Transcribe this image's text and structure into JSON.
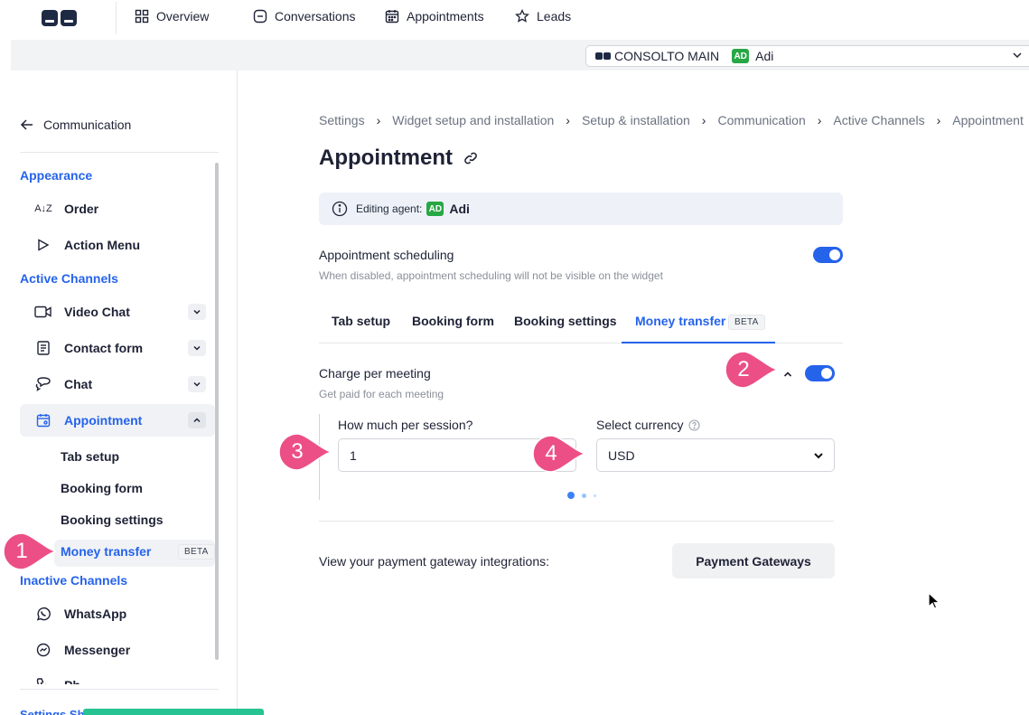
{
  "topnav": {
    "items": [
      {
        "label": "Overview",
        "icon": "grid-icon"
      },
      {
        "label": "Conversations",
        "icon": "chat-bubble-icon"
      },
      {
        "label": "Appointments",
        "icon": "calendar-icon"
      },
      {
        "label": "Leads",
        "icon": "star-icon"
      }
    ]
  },
  "agent_selector": {
    "account": "CONSOLTO MAIN",
    "agent_initials": "AD",
    "agent_name": "Adi"
  },
  "sidebar": {
    "back_label": "Communication",
    "sections": {
      "appearance": "Appearance",
      "active_channels": "Active Channels",
      "inactive_channels": "Inactive Channels",
      "settings_cutoff": "Settings Sh"
    },
    "appearance_items": [
      {
        "label": "Order",
        "icon": "sort-az-icon"
      },
      {
        "label": "Action Menu",
        "icon": "pointer-icon"
      }
    ],
    "active_items": [
      {
        "label": "Video Chat",
        "icon": "video-icon"
      },
      {
        "label": "Contact form",
        "icon": "form-icon"
      },
      {
        "label": "Chat",
        "icon": "chat-icon"
      },
      {
        "label": "Appointment",
        "icon": "calendar-icon"
      }
    ],
    "appointment_sub": [
      "Tab setup",
      "Booking form",
      "Booking settings",
      "Money transfer"
    ],
    "beta_label": "BETA",
    "inactive_items": [
      {
        "label": "WhatsApp",
        "icon": "whatsapp-icon"
      },
      {
        "label": "Messenger",
        "icon": "messenger-icon"
      },
      {
        "label": "Ph",
        "icon": "phone-icon"
      }
    ]
  },
  "breadcrumb": [
    "Settings",
    "Widget setup and installation",
    "Setup & installation",
    "Communication",
    "Active Channels",
    "Appointment"
  ],
  "page": {
    "title": "Appointment",
    "editing_label": "Editing agent:",
    "agent_initials": "AD",
    "agent_name": "Adi"
  },
  "scheduling": {
    "label": "Appointment scheduling",
    "description": "When disabled, appointment scheduling will not be visible on the widget",
    "enabled": true
  },
  "tabs": [
    "Tab setup",
    "Booking form",
    "Booking settings",
    "Money transfer"
  ],
  "tab_beta": "BETA",
  "charge": {
    "label": "Charge per meeting",
    "description": "Get paid for each meeting",
    "enabled": true,
    "session_label": "How much per session?",
    "session_value": "1",
    "currency_label": "Select currency",
    "currency_value": "USD"
  },
  "gateway": {
    "text": "View your payment gateway integrations:",
    "button": "Payment Gateways"
  },
  "markers": [
    "1",
    "2",
    "3",
    "4"
  ],
  "colors": {
    "accent": "#2563eb",
    "marker": "#ec4f86",
    "agent_badge": "#28a745",
    "green_strip": "#27c392"
  }
}
